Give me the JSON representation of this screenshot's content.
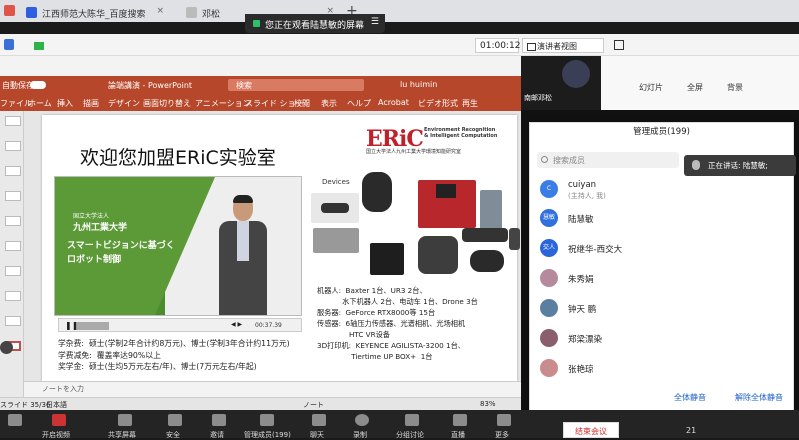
{
  "browser": {
    "tabs": [
      {
        "title": "江西师范大陈华_百度搜索",
        "active": false
      },
      {
        "title": "邓松",
        "active": false
      }
    ],
    "new_tab": "+",
    "close": "×"
  },
  "share_banner": {
    "text": "您正在观看陆慧敏的屏幕"
  },
  "meeting": {
    "timer": "01:00:12",
    "view_button": "演讲者视图"
  },
  "ppt": {
    "autosave": "自動保存",
    "filename": "論端講演 - PowerPoint",
    "search": "検索",
    "user": "lu huimin",
    "ribbon_tabs": [
      "ファイル",
      "ホーム",
      "挿入",
      "描画",
      "デザイン",
      "画面切り替え",
      "アニメーション",
      "スライド ショー",
      "校閲",
      "表示",
      "ヘルプ",
      "Acrobat",
      "ビデオ形式",
      "再生"
    ],
    "notes_placeholder": "ノートを入力",
    "status": {
      "slide": "スライド 35/36",
      "lang": "日本語",
      "notes": "ノート",
      "zoom": "83%"
    }
  },
  "slide": {
    "title": "欢迎您加盟ERiC实验室",
    "logo": {
      "text": "ERiC",
      "en_line1": "Environment Recognition",
      "en_line2": "& Intelligent Computation",
      "zh": "国立大学法人九州工業大学環境知能研究室"
    },
    "video": {
      "univ_small": "国立大学法人",
      "univ": "九州工業大学",
      "jp_line1": "スマートビジョンに基づく",
      "jp_line2": "ロボット制御",
      "time": "00:37.39"
    },
    "devices_label": "Devices",
    "specs": [
      "机器人:  Baxter 1台、UR3 2台、",
      "           水下机器人 2台、电动车 1台、Drone 3台",
      "服务器:  GeForce RTX8000等 15台",
      "传感器:  6轴压力传感器、光谱相机、光场相机",
      "              HTC VR设备",
      "3D打印机:  KEYENCE AGILISTA-3200 1台、",
      "               Tiertime UP BOX+  1台"
    ],
    "fees": [
      "学杂费:  硕士(学制2年合计约8万元)、博士(学制3年合计约11万元)",
      "学费减免:  覆盖率达90%以上",
      "奖学金:  硕士(生均5万元左右/年)、博士(7万元左右/年起)"
    ]
  },
  "right_panel": {
    "presenter": "南邮邓松",
    "toolbar": {
      "slides": "幻灯片",
      "fullscreen": "全屏",
      "background": "背景"
    },
    "speaking": "正在讲话: 陆慧敏;",
    "members_title": "管理成员(199)",
    "search_placeholder": "搜索成员",
    "members": [
      {
        "name": "cuiyan",
        "sub": "(主持人, 我)",
        "avatar": "C",
        "color": "#3b7de6"
      },
      {
        "name": "陆慧敏",
        "sub": "",
        "avatar": "慧敏",
        "color": "#2f6fde"
      },
      {
        "name": "祝继华-西交大",
        "sub": "",
        "avatar": "交人",
        "color": "#2a66d9"
      },
      {
        "name": "朱秀娟",
        "sub": "",
        "avatar": "",
        "color": "#b48a9c"
      },
      {
        "name": "钟天 鹏",
        "sub": "",
        "avatar": "",
        "color": "#5b7fa0"
      },
      {
        "name": "郑梁漂染",
        "sub": "",
        "avatar": "",
        "color": "#8b5e6e"
      },
      {
        "name": "张艳琼",
        "sub": "",
        "avatar": "",
        "color": "#c98c8c"
      }
    ],
    "mute_all": "全体静音",
    "unmute_all": "解除全体静音"
  },
  "bottom": {
    "items": [
      "开启视频",
      "共享屏幕",
      "安全",
      "邀请",
      "管理成员(199)",
      "聊天",
      "录制",
      "分组讨论",
      "直播",
      "更多"
    ],
    "end_meeting": "结束会议",
    "count": "21"
  }
}
